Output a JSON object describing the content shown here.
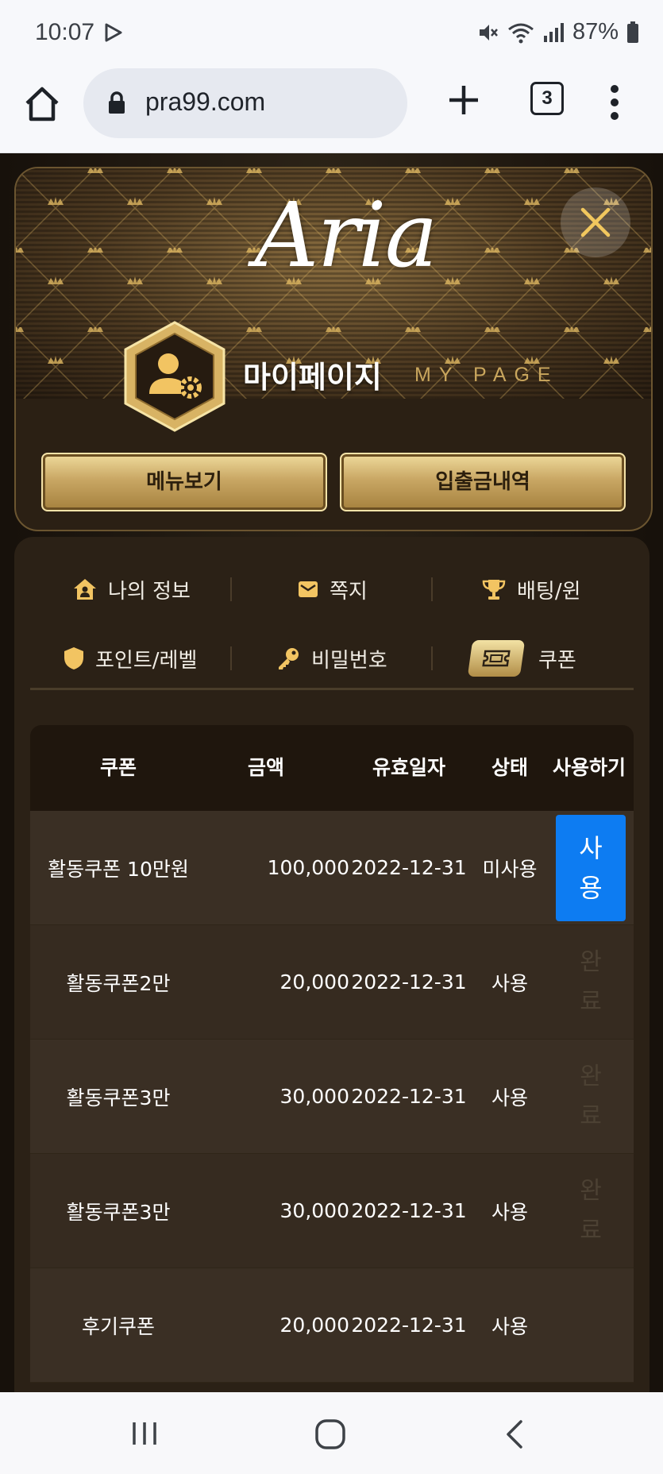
{
  "status_bar": {
    "time": "10:07",
    "battery": "87%",
    "icons": [
      "play-icon",
      "mute-icon",
      "wifi-icon",
      "signal-icon",
      "battery-icon"
    ]
  },
  "browser": {
    "url": "pra99.com",
    "tab_count": "3",
    "icons": [
      "home-icon",
      "lock-icon",
      "plus-icon",
      "more-icon"
    ]
  },
  "header": {
    "logo": "Aria",
    "title": "마이페이지",
    "subtitle": "MY PAGE",
    "buttons": {
      "menu": "메뉴보기",
      "history": "입출금내역"
    }
  },
  "menu": {
    "items": [
      {
        "label": "나의 정보",
        "icon": "house-user-icon"
      },
      {
        "label": "쪽지",
        "icon": "envelope-icon"
      },
      {
        "label": "배팅/윈",
        "icon": "trophy-icon"
      },
      {
        "label": "포인트/레벨",
        "icon": "shield-icon"
      },
      {
        "label": "비밀번호",
        "icon": "key-icon"
      },
      {
        "label": "쿠폰",
        "icon": "ticket-icon",
        "active": true
      }
    ]
  },
  "coupon_table": {
    "headers": [
      "쿠폰",
      "금액",
      "유효일자",
      "상태",
      "사용하기"
    ],
    "rows": [
      {
        "name": "활동쿠폰 10만원",
        "amount": "100,000",
        "date": "2022-12-31",
        "status": "미사용",
        "action": "사용"
      },
      {
        "name": "활동쿠폰2만",
        "amount": "20,000",
        "date": "2022-12-31",
        "status": "사용",
        "action": "완료"
      },
      {
        "name": "활동쿠폰3만",
        "amount": "30,000",
        "date": "2022-12-31",
        "status": "사용",
        "action": "완료"
      },
      {
        "name": "활동쿠폰3만",
        "amount": "30,000",
        "date": "2022-12-31",
        "status": "사용",
        "action": "완료"
      },
      {
        "name": "후기쿠폰",
        "amount": "20,000",
        "date": "2022-12-31",
        "status": "사용",
        "action": ""
      }
    ]
  },
  "colors": {
    "gold": "#c9a65d",
    "use_button": "#0d7cf2",
    "background": "#1b140d"
  }
}
